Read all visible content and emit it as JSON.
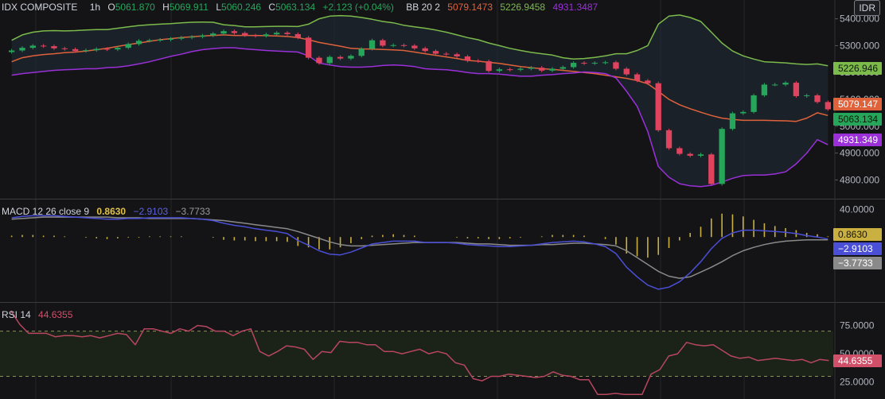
{
  "header": {
    "symbol": "IDX COMPOSITE",
    "interval": "1h",
    "open_label": "O",
    "open": "5061.870",
    "high_label": "H",
    "high": "5069.911",
    "low_label": "L",
    "low": "5060.246",
    "close_label": "C",
    "close": "5063.134",
    "change": "+2.123 (+0.04%)",
    "bb_label": "BB 20 2",
    "bb_basis": "5079.1473",
    "bb_upper": "5226.9458",
    "bb_lower": "4931.3487",
    "currency": "IDR"
  },
  "macd_legend": {
    "label": "MACD 12 26 close 9",
    "hist": "0.8630",
    "macd": "−2.9103",
    "signal": "−3.7733"
  },
  "rsi_legend": {
    "label": "RSI 14",
    "value": "44.6355"
  },
  "colors": {
    "background": "#141417",
    "grid": "#26262b",
    "up": "#26a65b",
    "down": "#e0435e",
    "bb_upper": "#7cba4b",
    "bb_basis": "#e0623a",
    "bb_lower": "#9b30d9",
    "bb_fill": "#1e2a36",
    "macd": "#4a4fd6",
    "signal": "#8a8a8a",
    "hist": "#c9b040",
    "rsi": "#b8465f",
    "rsi_band": "#1c2418"
  },
  "chart_data": [
    {
      "type": "candlestick",
      "title": "IDX COMPOSITE",
      "y_ticks": [
        "5400.000",
        "5300.000",
        "5200.000",
        "5100.000",
        "5000.000",
        "4900.000",
        "4800.000"
      ],
      "ylim": [
        4730,
        5470
      ],
      "price_tags": [
        {
          "label": "5226.946",
          "value": 5226.946,
          "series": "bb_upper"
        },
        {
          "label": "5079.147",
          "value": 5079.147,
          "series": "bb_basis"
        },
        {
          "label": "5063.134",
          "value": 5063.134,
          "series": "up"
        },
        {
          "label": "4931.349",
          "value": 4931.349,
          "series": "bb_lower"
        }
      ],
      "bars": 78,
      "close": [
        5282,
        5292,
        5300,
        5298,
        5290,
        5287,
        5280,
        5283,
        5288,
        5286,
        5292,
        5306,
        5318,
        5320,
        5322,
        5326,
        5330,
        5333,
        5338,
        5345,
        5354,
        5347,
        5338,
        5336,
        5342,
        5348,
        5343,
        5330,
        5255,
        5235,
        5258,
        5252,
        5262,
        5288,
        5320,
        5300,
        5302,
        5300,
        5290,
        5280,
        5270,
        5268,
        5260,
        5244,
        5242,
        5206,
        5212,
        5210,
        5214,
        5218,
        5207,
        5214,
        5220,
        5236,
        5234,
        5236,
        5238,
        5214,
        5193,
        5170,
        5160,
        4985,
        4918,
        4897,
        4890,
        4895,
        4785,
        4990,
        5048,
        5053,
        5115,
        5155,
        5155,
        5162,
        5112,
        5115,
        5090,
        5063
      ],
      "bb_upper": [
        5320,
        5340,
        5350,
        5355,
        5356,
        5355,
        5356,
        5358,
        5360,
        5360,
        5365,
        5370,
        5375,
        5378,
        5380,
        5382,
        5385,
        5387,
        5388,
        5387,
        5378,
        5375,
        5370,
        5370,
        5371,
        5372,
        5372,
        5371,
        5380,
        5400,
        5410,
        5412,
        5410,
        5405,
        5398,
        5390,
        5385,
        5376,
        5370,
        5365,
        5358,
        5350,
        5340,
        5330,
        5322,
        5310,
        5300,
        5290,
        5282,
        5275,
        5270,
        5265,
        5255,
        5250,
        5252,
        5256,
        5262,
        5270,
        5270,
        5282,
        5300,
        5380,
        5410,
        5414,
        5405,
        5390,
        5350,
        5310,
        5280,
        5262,
        5250,
        5240,
        5238,
        5236,
        5232,
        5230,
        5232,
        5225
      ],
      "bb_basis": [
        5240,
        5255,
        5262,
        5267,
        5270,
        5274,
        5276,
        5280,
        5285,
        5290,
        5297,
        5304,
        5310,
        5316,
        5322,
        5326,
        5330,
        5333,
        5336,
        5338,
        5340,
        5338,
        5338,
        5338,
        5337,
        5336,
        5334,
        5330,
        5322,
        5312,
        5305,
        5298,
        5290,
        5288,
        5287,
        5286,
        5284,
        5282,
        5276,
        5270,
        5264,
        5258,
        5252,
        5245,
        5242,
        5238,
        5234,
        5228,
        5222,
        5218,
        5214,
        5212,
        5208,
        5204,
        5200,
        5196,
        5190,
        5184,
        5178,
        5170,
        5158,
        5130,
        5100,
        5080,
        5065,
        5052,
        5040,
        5030,
        5025,
        5022,
        5022,
        5022,
        5021,
        5020,
        5018,
        5030,
        5050,
        5040
      ],
      "bb_lower": [
        5190,
        5196,
        5200,
        5204,
        5208,
        5210,
        5212,
        5214,
        5214,
        5218,
        5220,
        5225,
        5232,
        5240,
        5250,
        5260,
        5268,
        5278,
        5285,
        5289,
        5292,
        5292,
        5288,
        5285,
        5282,
        5280,
        5278,
        5276,
        5262,
        5235,
        5228,
        5222,
        5220,
        5220,
        5222,
        5226,
        5228,
        5226,
        5222,
        5214,
        5212,
        5210,
        5206,
        5200,
        5196,
        5196,
        5194,
        5190,
        5186,
        5186,
        5190,
        5192,
        5196,
        5198,
        5202,
        5200,
        5196,
        5180,
        5130,
        5074,
        4980,
        4850,
        4810,
        4786,
        4778,
        4775,
        4780,
        4792,
        4806,
        4816,
        4818,
        4818,
        4822,
        4830,
        4860,
        4900,
        4950,
        4931
      ]
    },
    {
      "type": "line+bar",
      "title": "MACD 12 26 close 9",
      "y_ticks": [
        "40.0000"
      ],
      "ylim": [
        -90,
        50
      ],
      "value_tags": [
        {
          "label": "0.8630",
          "value": 0.863,
          "series": "hist"
        },
        {
          "label": "−2.9103",
          "value": -2.9103,
          "series": "macd"
        },
        {
          "label": "−3.7733",
          "value": -3.7733,
          "series": "signal"
        }
      ],
      "macd": [
        28,
        30,
        31,
        31,
        31,
        30,
        29,
        28,
        27,
        26,
        26,
        27,
        27,
        28,
        28,
        28,
        28,
        27,
        26,
        24,
        20,
        17,
        15,
        12,
        10,
        8,
        5,
        -5,
        -12,
        -20,
        -25,
        -26,
        -22,
        -16,
        -10,
        -8,
        -6,
        -6,
        -6,
        -8,
        -8,
        -8,
        -9,
        -11,
        -12,
        -13,
        -14,
        -14,
        -13,
        -12,
        -10,
        -8,
        -7,
        -6,
        -7,
        -10,
        -14,
        -24,
        -44,
        -58,
        -70,
        -76,
        -73,
        -65,
        -52,
        -36,
        -17,
        -2,
        6,
        10,
        10,
        9,
        8,
        7,
        5,
        2,
        0,
        -3
      ],
      "signal": [
        26,
        27,
        28,
        29,
        29,
        29,
        29,
        29,
        29,
        29,
        28,
        28,
        28,
        27,
        27,
        27,
        27,
        27,
        26,
        25,
        24,
        22,
        20,
        18,
        16,
        14,
        12,
        8,
        3,
        -2,
        -7,
        -11,
        -13,
        -13,
        -12,
        -11,
        -10,
        -9,
        -8,
        -8,
        -8,
        -8,
        -8,
        -9,
        -10,
        -10,
        -11,
        -12,
        -12,
        -12,
        -11,
        -11,
        -10,
        -9,
        -9,
        -10,
        -11,
        -13,
        -20,
        -30,
        -40,
        -50,
        -57,
        -60,
        -58,
        -51,
        -44,
        -36,
        -27,
        -20,
        -15,
        -11,
        -8,
        -6,
        -5,
        -4,
        -4,
        -4
      ],
      "hist": [
        2,
        3,
        3,
        2,
        2,
        1,
        0,
        -1,
        -2,
        -3,
        -2,
        -1,
        -1,
        1,
        1,
        1,
        1,
        0,
        0,
        -1,
        -4,
        -5,
        -5,
        -6,
        -6,
        -6,
        -7,
        -13,
        -15,
        -18,
        -18,
        -15,
        -9,
        -3,
        2,
        3,
        4,
        3,
        2,
        0,
        0,
        0,
        -1,
        -2,
        -2,
        -3,
        -3,
        -2,
        -1,
        0,
        1,
        3,
        3,
        3,
        2,
        0,
        -3,
        -11,
        -24,
        -28,
        -30,
        -26,
        -16,
        -5,
        6,
        15,
        27,
        34,
        33,
        30,
        25,
        20,
        16,
        13,
        10,
        6,
        4,
        1
      ]
    },
    {
      "type": "line",
      "title": "RSI 14",
      "y_ticks": [
        "75.0000",
        "50.0000",
        "25.0000"
      ],
      "ylim": [
        10,
        95
      ],
      "bands": [
        70,
        30
      ],
      "value_tags": [
        {
          "label": "44.6355",
          "value": 44.6355,
          "series": "rsi"
        }
      ],
      "rsi": [
        88,
        76,
        68,
        68,
        68,
        65,
        66,
        66,
        65,
        66,
        64,
        66,
        68,
        67,
        58,
        72,
        72,
        70,
        68,
        72,
        70,
        75,
        74,
        70,
        70,
        66,
        70,
        72,
        52,
        48,
        52,
        57,
        56,
        54,
        45,
        52,
        51,
        61,
        60,
        60,
        58,
        58,
        52,
        52,
        50,
        52,
        54,
        50,
        52,
        50,
        42,
        40,
        28,
        26,
        30,
        30,
        32,
        31,
        30,
        29,
        30,
        34,
        31,
        30,
        27,
        27,
        14,
        14,
        15,
        14,
        14,
        14,
        32,
        36,
        48,
        50,
        60,
        58,
        57,
        58,
        53,
        48,
        46,
        47,
        44,
        45,
        46,
        45,
        44,
        45,
        42,
        45,
        44
      ]
    }
  ]
}
